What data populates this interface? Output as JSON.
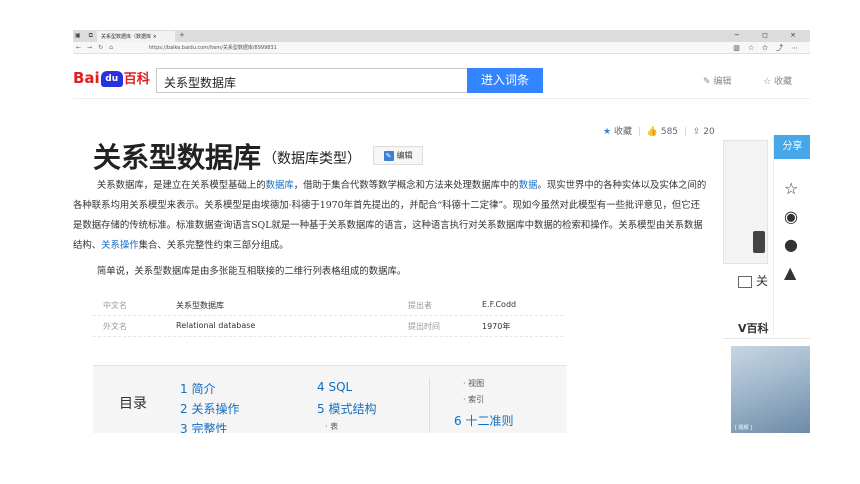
{
  "browser": {
    "tab_title": "关系型数据库（数据库 ×",
    "new_tab": "+",
    "url": "https://baike.baidu.com/item/关系型数据库/8999831",
    "window_controls": "− ◻ ×"
  },
  "header": {
    "logo_bai": "Bai",
    "logo_du": "du",
    "logo_baike": "百科",
    "search_value": "关系型数据库",
    "search_button": "进入词条",
    "edit_label": "编辑",
    "fav_label": "收藏"
  },
  "article": {
    "actions": {
      "fav": "收藏",
      "likes": "585",
      "shares": "20"
    },
    "title": "关系型数据库",
    "subtitle": "（数据库类型）",
    "edit_button": "编辑",
    "para1_a": "关系数据库，是建立在关系模型基础上的",
    "para1_link1": "数据库",
    "para1_b": "，借助于集合代数等数学概念和方法来处理数据库中的",
    "para1_link2": "数据",
    "para1_c": "。现实世界中的各种实体以及实体之间的各种联系均用关系模型来表示。关系模型是由埃德加·科德于1970年首先提出的，并配合“科德十二定律”。现如今虽然对此模型有一些批评意见，但它还是数据存储的传统标准。标准数据查询语言SQL就是一种基于关系数据库的语言，这种语言执行对关系数据库中数据的检索和操作。关系模型由关系数据结构、",
    "para1_link3": "关系操作",
    "para1_d": "集合、关系完整性约束三部分组成。",
    "para2": "简单说，关系型数据库是由多张能互相联接的二维行列表格组成的数据库。",
    "basic_info": [
      {
        "k1": "中文名",
        "v1": "关系型数据库",
        "k2": "提出者",
        "v2": "E.F.Codd"
      },
      {
        "k1": "外文名",
        "v1": "Relational database",
        "k2": "提出时间",
        "v2": "1970年"
      }
    ],
    "toc": {
      "title": "目录",
      "items": [
        "1 简介",
        "2 关系操作",
        "3 完整性",
        "4 SQL",
        "5 模式结构",
        "6 十二准则"
      ],
      "subs": [
        "· 表",
        "· 视图",
        "· 索引"
      ]
    }
  },
  "sidebar": {
    "album_label": "关",
    "vbaike": "V百科",
    "share_label": "分享",
    "video_caption": "[ 视频 ]"
  },
  "colors": {
    "accent": "#3385ff",
    "link": "#136ec2",
    "logo_red": "#de2021",
    "share_blue": "#47a7e8"
  }
}
